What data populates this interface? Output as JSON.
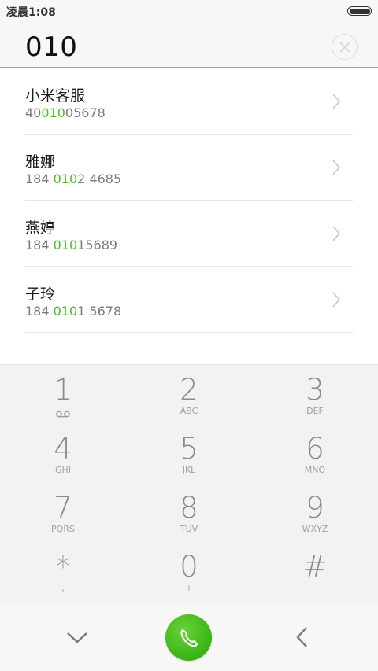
{
  "status_bar": {
    "time": "凌晨1:08"
  },
  "dial_input": {
    "value": "010"
  },
  "results": [
    {
      "name": "小米客服",
      "number_pre": "40",
      "number_match": "010",
      "number_post": "05678"
    },
    {
      "name": "雅娜",
      "number_pre": "184 ",
      "number_match": "010",
      "number_post": "2 4685"
    },
    {
      "name": "燕婷",
      "number_pre": "184 ",
      "number_match": "010",
      "number_post": "15689"
    },
    {
      "name": "子玲",
      "number_pre": "184 ",
      "number_match": "010",
      "number_post": "1 5678"
    }
  ],
  "keypad": [
    {
      "digit": "1",
      "letters": ""
    },
    {
      "digit": "2",
      "letters": "ABC"
    },
    {
      "digit": "3",
      "letters": "DEF"
    },
    {
      "digit": "4",
      "letters": "GHI"
    },
    {
      "digit": "5",
      "letters": "JKL"
    },
    {
      "digit": "6",
      "letters": "MNO"
    },
    {
      "digit": "7",
      "letters": "PQRS"
    },
    {
      "digit": "8",
      "letters": "TUV"
    },
    {
      "digit": "9",
      "letters": "WXYZ"
    },
    {
      "digit": "*",
      "letters": ","
    },
    {
      "digit": "0",
      "letters": "+"
    },
    {
      "digit": "#",
      "letters": ""
    }
  ],
  "colors": {
    "highlight": "#4cbb2a",
    "call_button": "#39b313",
    "underline": "#5fb0e5"
  },
  "icons": {
    "key_1_sub": "voicemail-icon",
    "clear": "clear-icon",
    "collapse": "chevron-down-icon",
    "call": "phone-icon",
    "back": "backspace-icon"
  }
}
